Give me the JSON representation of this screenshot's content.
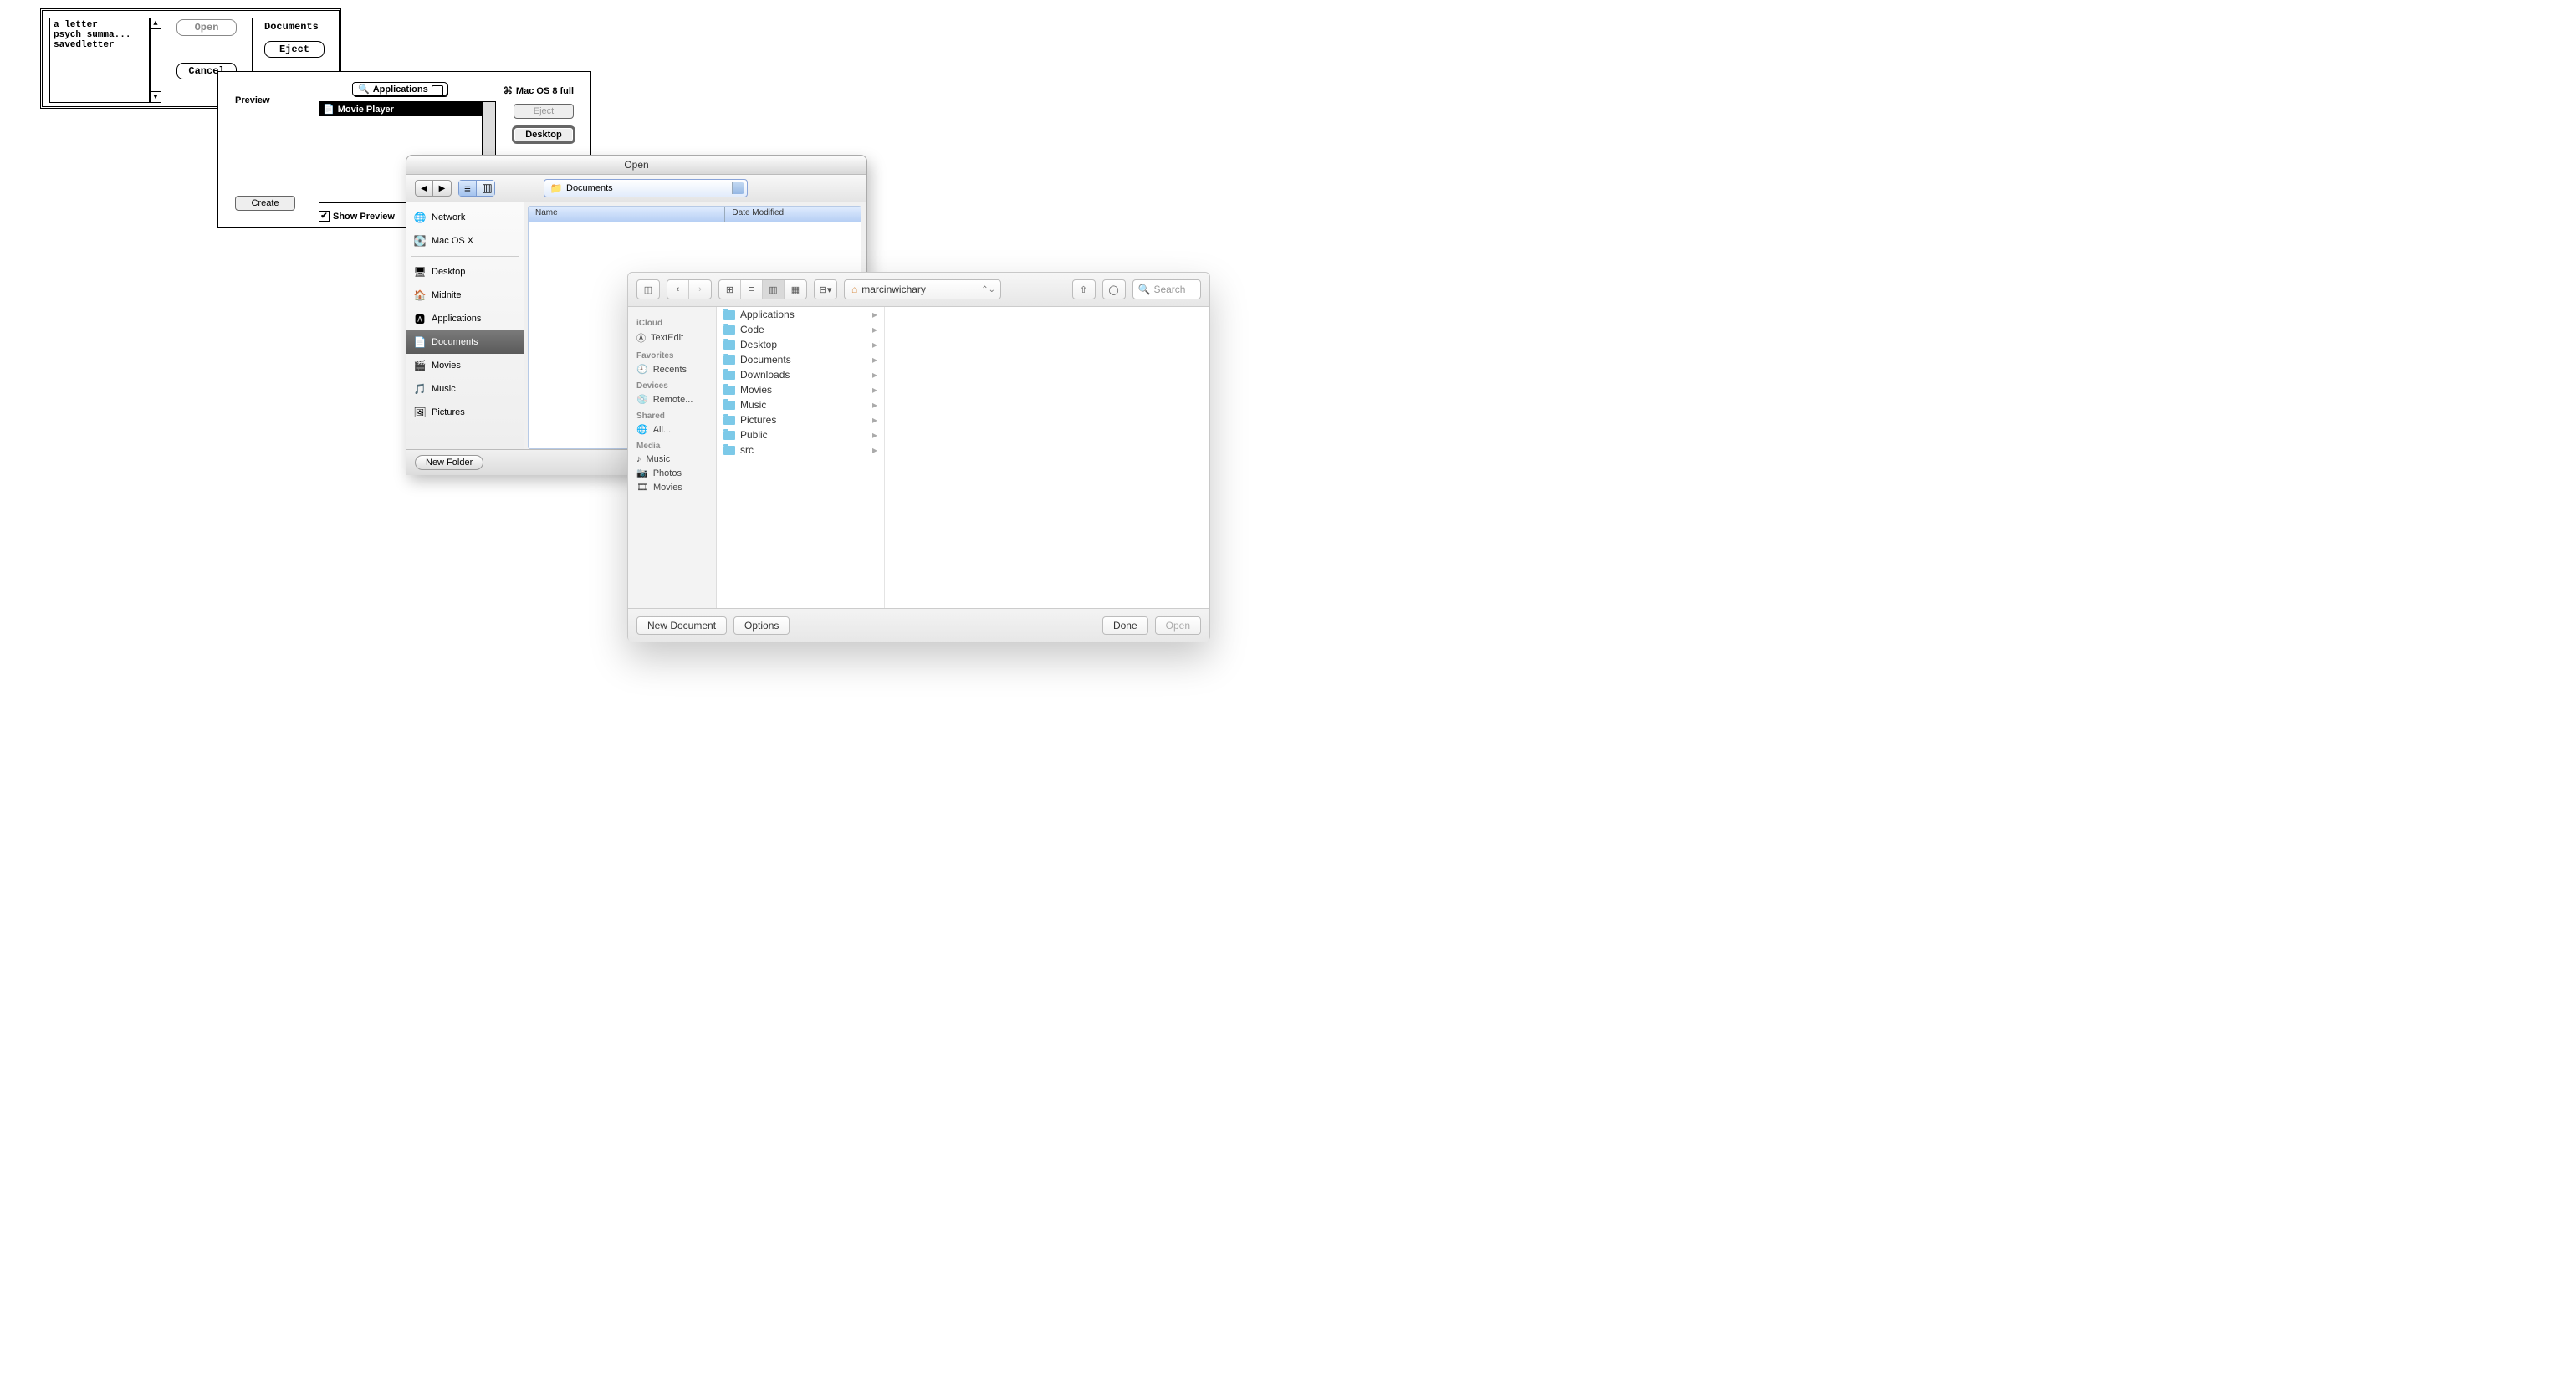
{
  "dlg1": {
    "list": [
      "a letter",
      "psych summa...",
      "savedletter"
    ],
    "open": "Open",
    "eject": "Eject",
    "cancel": "Cancel",
    "volume": "Documents"
  },
  "dlg2": {
    "preview": "Preview",
    "popup": "Applications",
    "list_item": "Movie Player",
    "drive": "Mac OS 8 full",
    "eject": "Eject",
    "desktop": "Desktop",
    "create": "Create",
    "show_preview": "Show Preview"
  },
  "dlg3": {
    "title": "Open",
    "path": "Documents",
    "col_name": "Name",
    "col_date": "Date Modified",
    "sidebar": {
      "top": [
        {
          "label": "Network",
          "icon": "🌐"
        },
        {
          "label": "Mac OS X",
          "icon": "💽"
        }
      ],
      "places": [
        {
          "label": "Desktop",
          "icon": "🖥"
        },
        {
          "label": "Midnite",
          "icon": "🏠"
        },
        {
          "label": "Applications",
          "icon": "🅰"
        },
        {
          "label": "Documents",
          "icon": "📄",
          "sel": true
        },
        {
          "label": "Movies",
          "icon": "🎬"
        },
        {
          "label": "Music",
          "icon": "🎵"
        },
        {
          "label": "Pictures",
          "icon": "🖼"
        }
      ]
    },
    "new_folder": "New Folder"
  },
  "dlg4": {
    "path": "marcinwichary",
    "search_placeholder": "Search",
    "sidebar": {
      "icloud_h": "iCloud",
      "icloud": [
        {
          "label": "TextEdit",
          "icon": "Ⓐ"
        }
      ],
      "fav_h": "Favorites",
      "fav": [
        {
          "label": "Recents",
          "icon": "🕘"
        }
      ],
      "dev_h": "Devices",
      "dev": [
        {
          "label": "Remote...",
          "icon": "💿"
        }
      ],
      "shared_h": "Shared",
      "shared": [
        {
          "label": "All...",
          "icon": "🌐"
        }
      ],
      "media_h": "Media",
      "media": [
        {
          "label": "Music",
          "icon": "♪"
        },
        {
          "label": "Photos",
          "icon": "📷"
        },
        {
          "label": "Movies",
          "icon": "🎞"
        }
      ]
    },
    "column": [
      "Applications",
      "Code",
      "Desktop",
      "Documents",
      "Downloads",
      "Movies",
      "Music",
      "Pictures",
      "Public",
      "src"
    ],
    "new_document": "New Document",
    "options": "Options",
    "done": "Done",
    "open": "Open"
  }
}
